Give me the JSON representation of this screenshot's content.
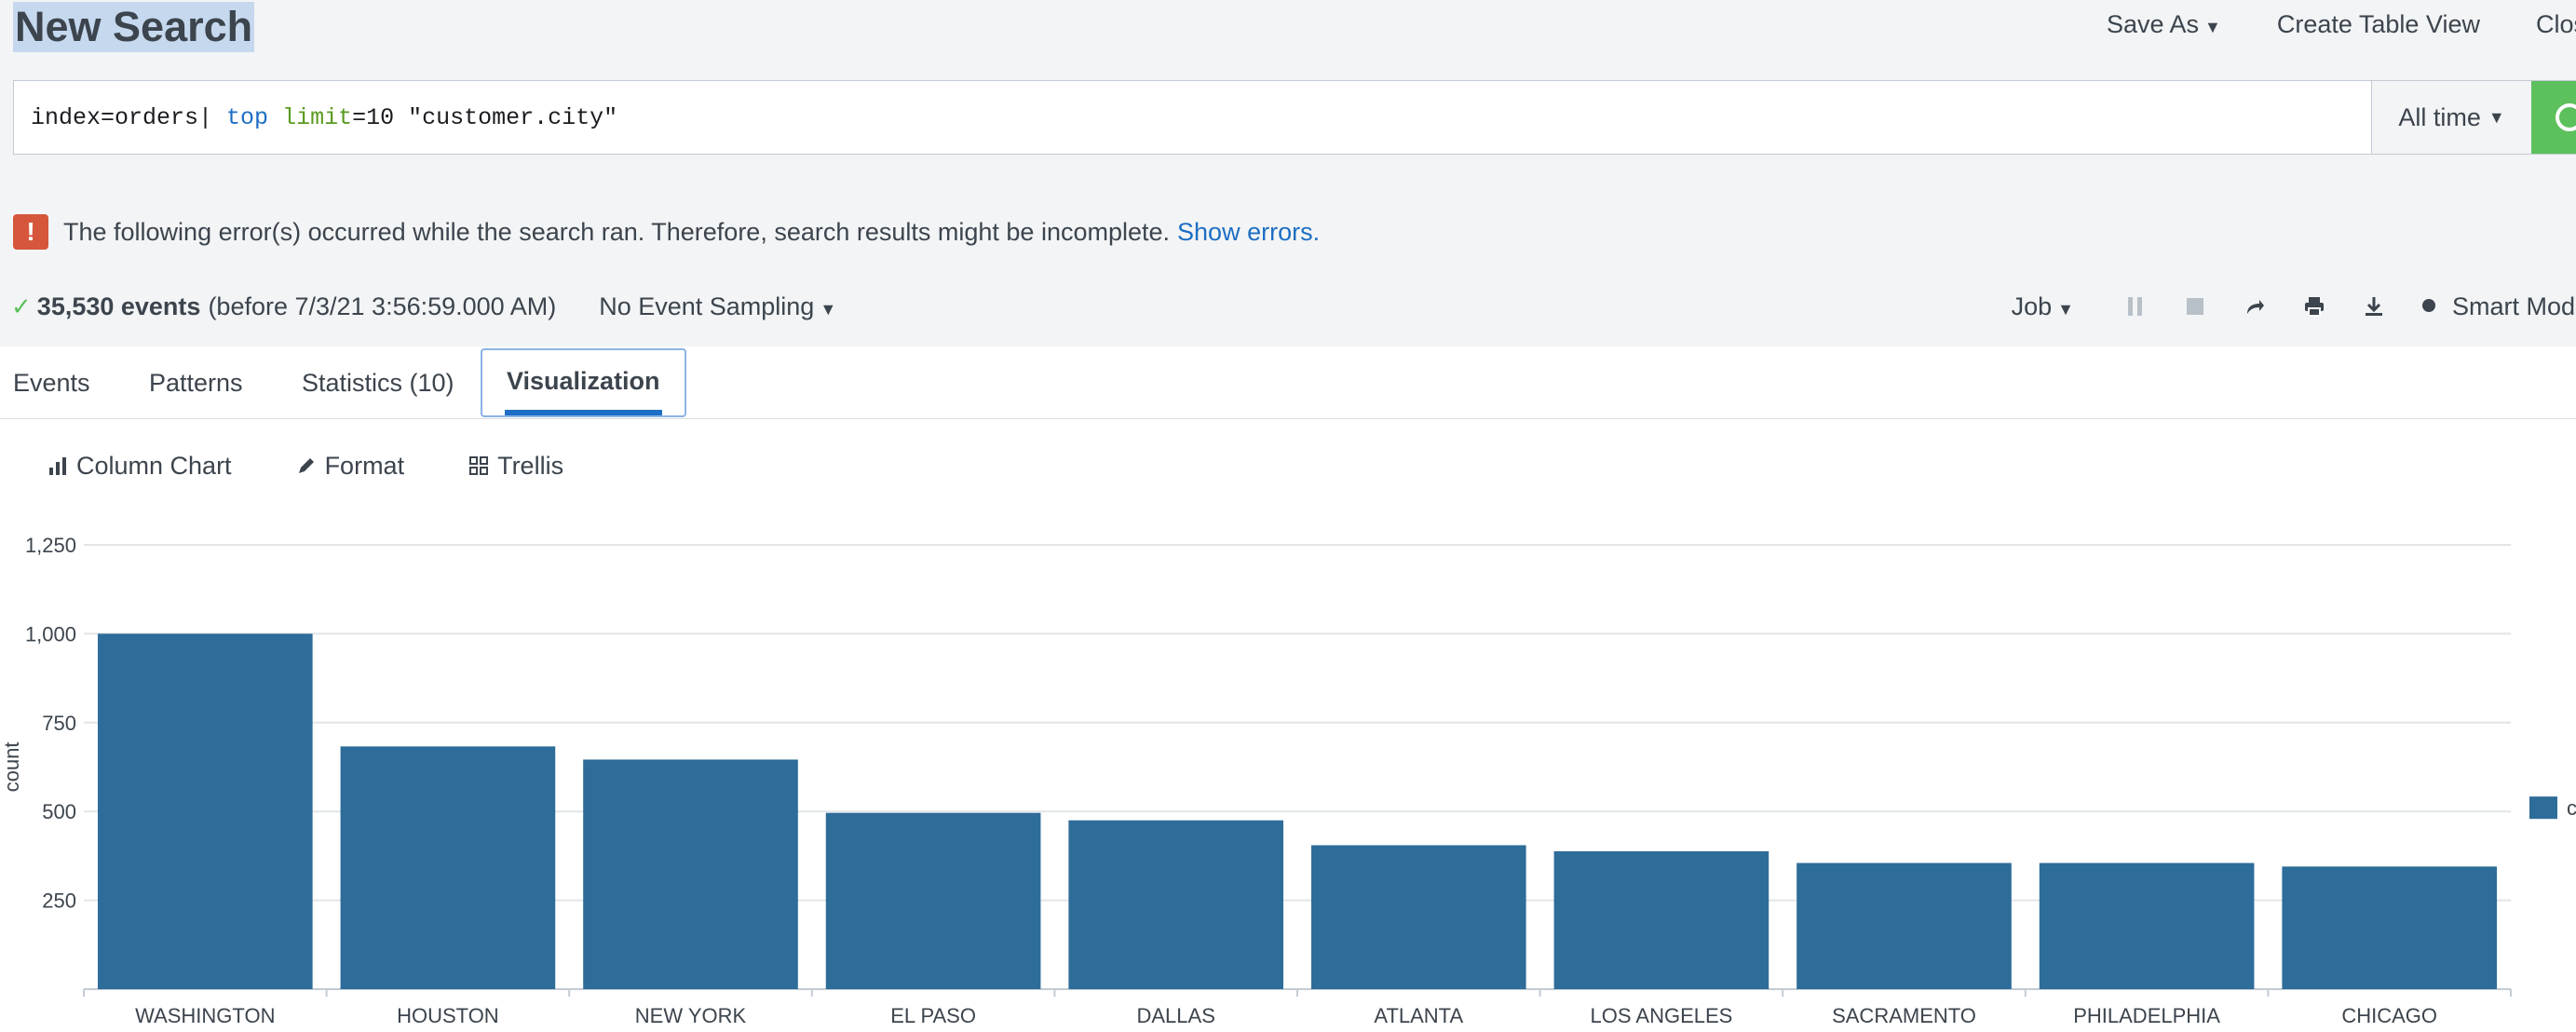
{
  "header": {
    "title": "New Search",
    "actions": [
      {
        "label": "Save As",
        "has_caret": true
      },
      {
        "label": "Create Table View",
        "has_caret": false
      },
      {
        "label": "Close",
        "has_caret": false
      }
    ]
  },
  "search": {
    "query_parts": [
      {
        "text": "index=orders| ",
        "style": "plain"
      },
      {
        "text": "top",
        "style": "blue"
      },
      {
        "text": " ",
        "style": "plain"
      },
      {
        "text": "limit",
        "style": "green"
      },
      {
        "text": "=10 \"customer.city\"",
        "style": "plain"
      }
    ],
    "time_range": "All time"
  },
  "error": {
    "icon": "exclamation-icon",
    "message": "The following error(s) occurred while the search ran. Therefore, search results might be incomplete.",
    "link": "Show errors."
  },
  "status": {
    "events_count": "35,530 events",
    "before_text": "(before 7/3/21 3:56:59.000 AM)",
    "sampling": "No Event Sampling"
  },
  "job_controls": {
    "job_label": "Job",
    "mode_label": "Smart Mode"
  },
  "tabs": [
    {
      "label": "Events",
      "active": false
    },
    {
      "label": "Patterns",
      "active": false
    },
    {
      "label": "Statistics (10)",
      "active": false
    },
    {
      "label": "Visualization",
      "active": true
    }
  ],
  "viz_toolbar": {
    "chart_type": "Column Chart",
    "format": "Format",
    "trellis": "Trellis"
  },
  "colors": {
    "bar": "#2e6c99",
    "accent": "#1d6ec4",
    "success": "#5cc05c",
    "error": "#d6563c"
  },
  "chart_data": {
    "type": "bar",
    "categories": [
      "WASHINGTON",
      "HOUSTON",
      "NEW YORK",
      "EL PASO",
      "DALLAS",
      "ATLANTA",
      "LOS ANGELES",
      "SACRAMENTO",
      "PHILADELPHIA",
      "CHICAGO"
    ],
    "values": [
      1000,
      683,
      646,
      496,
      475,
      405,
      388,
      355,
      355,
      345
    ],
    "ylabel": "count",
    "ylim": [
      0,
      1250
    ],
    "yticks": [
      250,
      500,
      750,
      1000
    ],
    "ytick_labels": [
      "250",
      "500",
      "750",
      "1,000"
    ],
    "ymax_label": "1,250",
    "grid": true,
    "legend_position": "right",
    "legend_entries": [
      "c"
    ]
  }
}
